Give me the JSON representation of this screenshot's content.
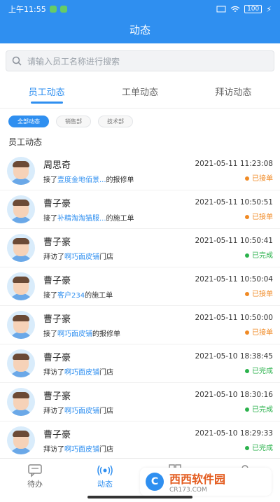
{
  "status_bar": {
    "time": "上午11:55",
    "battery": "100"
  },
  "header": {
    "title": "动态"
  },
  "search": {
    "placeholder": "请输入员工名称进行搜索"
  },
  "tabs": [
    {
      "label": "员工动态",
      "active": true
    },
    {
      "label": "工单动态",
      "active": false
    },
    {
      "label": "拜访动态",
      "active": false
    }
  ],
  "filters": [
    {
      "label": "全部动态",
      "active": true
    },
    {
      "label": "销售部",
      "active": false
    },
    {
      "label": "技术部",
      "active": false
    }
  ],
  "section_title": "员工动态",
  "activities": [
    {
      "name": "周思奇",
      "pre": "接了",
      "link": "壹度金地佰景...",
      "post": "的报修单",
      "time": "2021-05-11 11:23:08",
      "status": "已接单",
      "status_color": "#f08a24"
    },
    {
      "name": "曹子豪",
      "pre": "接了",
      "link": "补精淘淘猫服...",
      "post": "的施工单",
      "time": "2021-05-11 10:50:51",
      "status": "已接单",
      "status_color": "#f08a24"
    },
    {
      "name": "曹子豪",
      "pre": "拜访了",
      "link": "啊巧面皮铺",
      "post": "门店",
      "time": "2021-05-11 10:50:41",
      "status": "已完成",
      "status_color": "#2bb24c"
    },
    {
      "name": "曹子豪",
      "pre": "接了",
      "link": "客户234",
      "post": "的施工单",
      "time": "2021-05-11 10:50:04",
      "status": "已接单",
      "status_color": "#f08a24"
    },
    {
      "name": "曹子豪",
      "pre": "接了",
      "link": "啊巧面皮铺",
      "post": "的报修单",
      "time": "2021-05-11 10:50:00",
      "status": "已接单",
      "status_color": "#f08a24"
    },
    {
      "name": "曹子豪",
      "pre": "拜访了",
      "link": "啊巧面皮铺",
      "post": "门店",
      "time": "2021-05-10 18:38:45",
      "status": "已完成",
      "status_color": "#2bb24c"
    },
    {
      "name": "曹子豪",
      "pre": "拜访了",
      "link": "啊巧面皮铺",
      "post": "门店",
      "time": "2021-05-10 18:30:16",
      "status": "已完成",
      "status_color": "#2bb24c"
    },
    {
      "name": "曹子豪",
      "pre": "拜访了",
      "link": "啊巧面皮铺",
      "post": "门店",
      "time": "2021-05-10 18:29:33",
      "status": "已完成",
      "status_color": "#2bb24c"
    }
  ],
  "tabbar": [
    {
      "label": "待办",
      "icon": "message-icon",
      "active": false
    },
    {
      "label": "动态",
      "icon": "broadcast-icon",
      "active": true
    },
    {
      "label": "",
      "icon": "grid-icon",
      "active": false
    },
    {
      "label": "",
      "icon": "user-icon",
      "active": false
    }
  ],
  "watermark": {
    "title": "西西软件园",
    "url": "CR173.COM"
  },
  "colors": {
    "primary": "#2f8ff0",
    "orange": "#f08a24",
    "green": "#2bb24c"
  }
}
